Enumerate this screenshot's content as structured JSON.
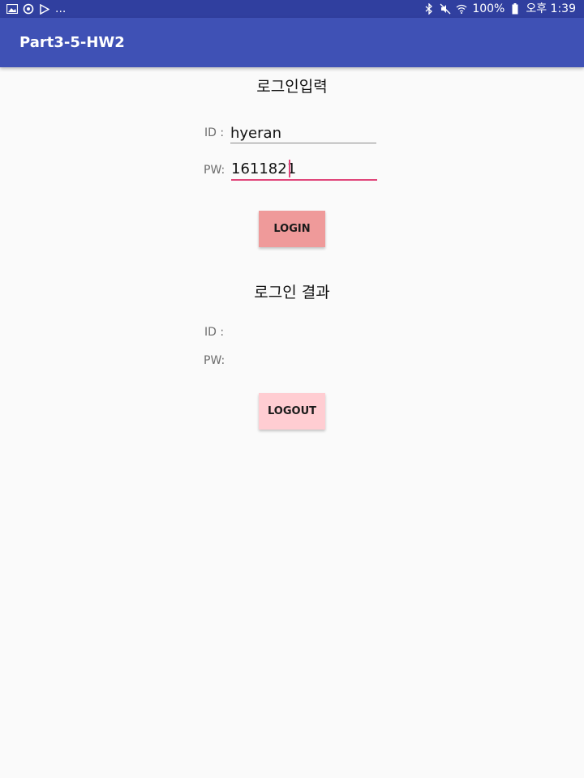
{
  "status_bar": {
    "left_icons": [
      "image-icon",
      "sync-icon",
      "play-store-icon"
    ],
    "left_more": "...",
    "right_icons": [
      "bluetooth-icon",
      "mute-icon",
      "wifi-icon"
    ],
    "battery": "100%",
    "time": "오후 1:39"
  },
  "app_bar": {
    "title": "Part3-5-HW2",
    "color": "#3f51b5"
  },
  "login_input": {
    "title": "로그인입력",
    "id_label": "ID :",
    "id_value": "hyeran",
    "pw_label": "PW:",
    "pw_value": "1611821",
    "login_button": "LOGIN"
  },
  "login_result": {
    "title": "로그인 결과",
    "id_label": "ID :",
    "id_value": "",
    "pw_label": "PW:",
    "pw_value": "",
    "logout_button": "LOGOUT"
  },
  "colors": {
    "accent": "#e0457a",
    "login_button": "#ef9a9a",
    "logout_button": "#ffcdd2",
    "status_bar": "#303f9f"
  }
}
